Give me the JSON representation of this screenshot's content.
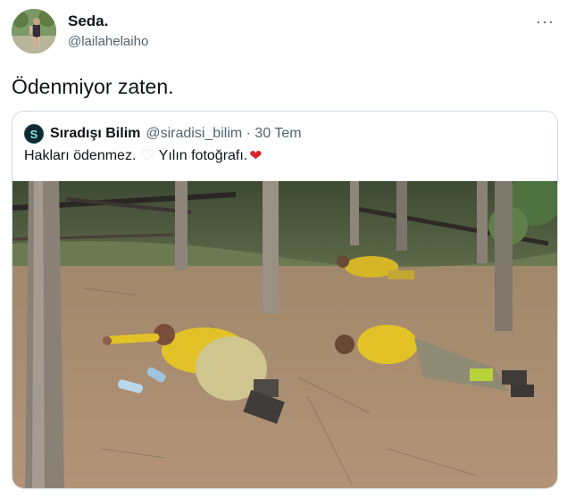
{
  "tweet": {
    "display_name": "Seda.",
    "handle": "@lailahelaiho",
    "more_label": "···",
    "text": "Ödenmiyor zaten."
  },
  "quote": {
    "avatar_letter": "S",
    "name": "Sıradışı Bilim",
    "handle": "@siradisi_bilim · 30 Tem",
    "text": "Hakları ödenmez.",
    "heart_white": "♡",
    "text2": "Yılın fotoğrafı.",
    "heart_red": "❤"
  },
  "colors": {
    "text": "#0f1419",
    "secondary": "#536471",
    "border": "#cfd9de",
    "uniform_yellow": "#e2c227",
    "forest_floor": "#a88a6c"
  }
}
